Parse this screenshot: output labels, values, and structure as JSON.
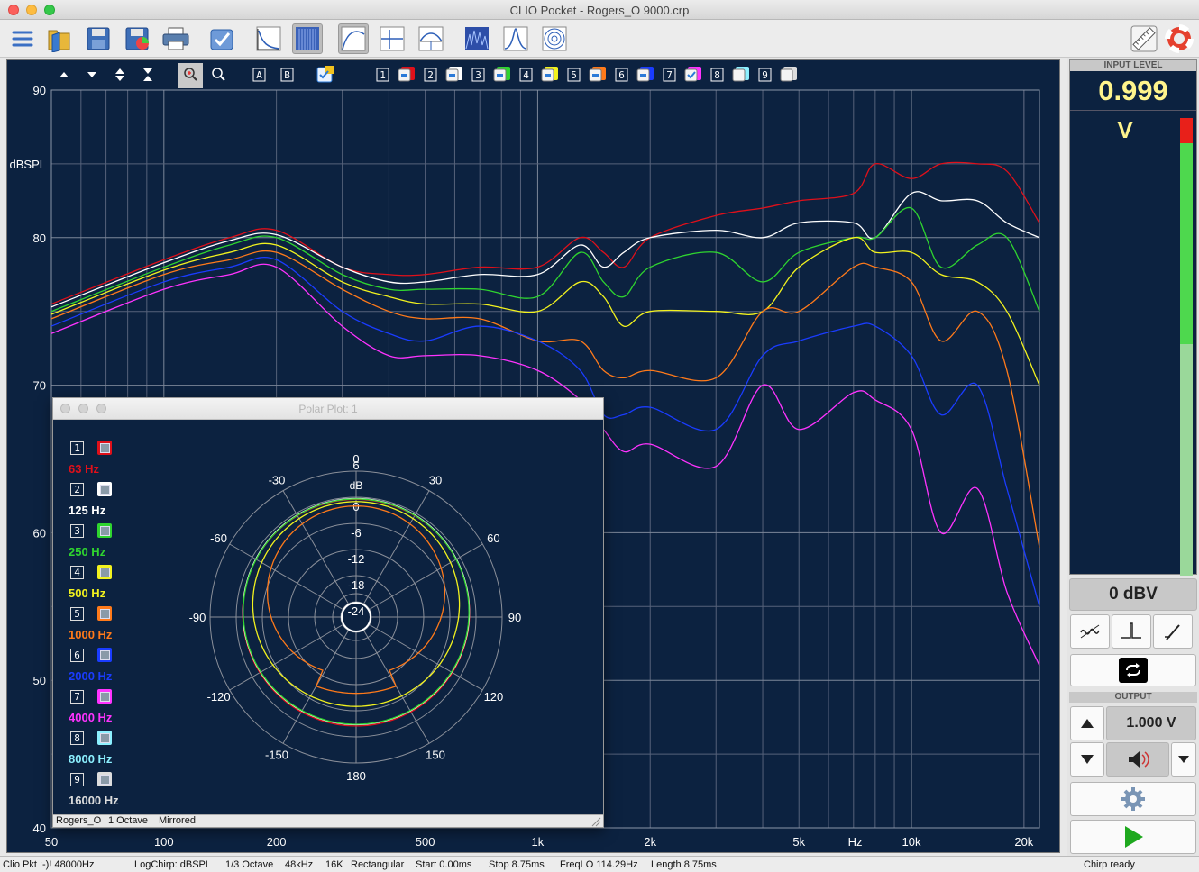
{
  "window": {
    "title": "CLIO Pocket - Rogers_O 9000.crp"
  },
  "toolbar": {
    "icons": [
      "menu-icon",
      "open-folder-icon",
      "save-icon",
      "save-as-icon",
      "print-icon",
      "checkmark-icon",
      "fft-analyzer-icon",
      "waterfall-icon",
      "frequency-response-icon",
      "impulse-response-icon",
      "phase-icon",
      "cumulative-spectral-decay-icon",
      "transfer-icon",
      "polar-plot-icon",
      "ruler-icon",
      "lifebuoy-help-icon"
    ]
  },
  "graph": {
    "controls": [
      "arrow-up-icon",
      "arrow-down-icon",
      "expand-icon",
      "compress-icon",
      "zoom-in-icon",
      "zoom-out-icon"
    ],
    "buttons": [
      "A",
      "B"
    ],
    "curve_numbers": [
      "1",
      "2",
      "3",
      "4",
      "5",
      "6",
      "7",
      "8",
      "9"
    ],
    "curve_colors": [
      "#e0101a",
      "#ffffff",
      "#2fd52f",
      "#f2f21e",
      "#ff7a1a",
      "#1a3cff",
      "#ff33ff",
      "#8cf0ff",
      "#dddddd"
    ],
    "y_axis": {
      "unit": "dBSPL",
      "ticks": [
        "90",
        "80",
        "70",
        "60",
        "50",
        "40"
      ]
    },
    "x_axis": {
      "unit": "Hz",
      "ticks": [
        "50",
        "100",
        "200",
        "500",
        "1k",
        "2k",
        "5k",
        "10k",
        "20k"
      ]
    }
  },
  "chart_data": {
    "type": "line",
    "title": "",
    "xlabel": "Hz",
    "ylabel": "dBSPL",
    "xscale": "log",
    "xlim": [
      50,
      22000
    ],
    "ylim": [
      40,
      90
    ],
    "grid": true,
    "series": [
      {
        "color": "#e0101a",
        "x": [
          50,
          100,
          150,
          200,
          300,
          400,
          500,
          700,
          1000,
          1300,
          1500,
          1700,
          2000,
          3000,
          4000,
          5000,
          7000,
          8000,
          10000,
          12000,
          15000,
          18000,
          22000
        ],
        "y": [
          75.5,
          78.5,
          80,
          80.5,
          78,
          77.5,
          77.5,
          78,
          78,
          80,
          79,
          78,
          80,
          81.5,
          82,
          82.5,
          83,
          85,
          84,
          85,
          85,
          84.5,
          81
        ]
      },
      {
        "color": "#ffffff",
        "x": [
          50,
          100,
          150,
          200,
          300,
          400,
          500,
          700,
          1000,
          1300,
          1500,
          1700,
          2000,
          3000,
          4000,
          5000,
          7000,
          8000,
          10000,
          12000,
          15000,
          18000,
          22000
        ],
        "y": [
          75.3,
          78.3,
          79.8,
          80.2,
          78,
          77,
          77,
          77.5,
          77.5,
          79.5,
          78,
          79,
          80,
          80.5,
          80,
          81,
          81,
          80,
          83,
          82.5,
          82.5,
          81,
          80
        ]
      },
      {
        "color": "#2fd52f",
        "x": [
          50,
          100,
          150,
          200,
          300,
          400,
          500,
          700,
          1000,
          1300,
          1500,
          1700,
          2000,
          3000,
          4000,
          5000,
          7000,
          8000,
          10000,
          12000,
          15000,
          18000,
          22000
        ],
        "y": [
          75,
          78,
          79.5,
          80,
          77.5,
          76.5,
          76.5,
          76.5,
          76,
          79,
          77,
          76,
          78,
          79,
          77,
          79,
          80,
          80,
          82,
          78,
          79.5,
          80,
          75
        ]
      },
      {
        "color": "#f2f21e",
        "x": [
          50,
          100,
          150,
          200,
          300,
          400,
          500,
          700,
          1000,
          1300,
          1500,
          1700,
          2000,
          3000,
          4000,
          5000,
          7000,
          8000,
          10000,
          12000,
          15000,
          18000,
          22000
        ],
        "y": [
          74.8,
          77.8,
          79,
          79.5,
          77,
          76,
          75.5,
          75.5,
          75,
          77,
          76,
          74,
          75,
          75,
          75,
          78,
          80,
          79,
          79,
          77.5,
          77,
          75,
          70
        ]
      },
      {
        "color": "#ff7a1a",
        "x": [
          50,
          100,
          150,
          200,
          300,
          400,
          500,
          700,
          1000,
          1300,
          1500,
          1700,
          2000,
          3000,
          4000,
          5000,
          7000,
          8000,
          10000,
          12000,
          15000,
          18000,
          22000
        ],
        "y": [
          74.5,
          77.5,
          78.5,
          79,
          76.5,
          75,
          74.5,
          74.5,
          73,
          73,
          71,
          70.5,
          71,
          70.5,
          75,
          75,
          78,
          78,
          77,
          73,
          75,
          71,
          59
        ]
      },
      {
        "color": "#1a3cff",
        "x": [
          50,
          100,
          150,
          200,
          300,
          400,
          500,
          700,
          1000,
          1300,
          1500,
          1700,
          2000,
          3000,
          4000,
          5000,
          7000,
          8000,
          10000,
          12000,
          15000,
          18000,
          22000
        ],
        "y": [
          74,
          77,
          78,
          78.5,
          75,
          73.5,
          73,
          74,
          73,
          71,
          68,
          68,
          68.5,
          67,
          72,
          73,
          74,
          74,
          72,
          68,
          70,
          63,
          55
        ]
      },
      {
        "color": "#ff33ff",
        "x": [
          50,
          100,
          150,
          200,
          300,
          400,
          500,
          700,
          1000,
          1300,
          1500,
          1700,
          2000,
          3000,
          4000,
          5000,
          7000,
          8000,
          10000,
          12000,
          15000,
          18000,
          22000
        ],
        "y": [
          73.5,
          76.5,
          77.5,
          78,
          74,
          72,
          72,
          72,
          71,
          69,
          67,
          65.5,
          66,
          64.5,
          70,
          67,
          69.5,
          69,
          67,
          60,
          63,
          56,
          51
        ]
      }
    ]
  },
  "polar": {
    "title": "Polar Plot: 1",
    "dB_label": "dB",
    "angle_labels": [
      "0",
      "30",
      "60",
      "90",
      "120",
      "150",
      "180",
      "-150",
      "-120",
      "-90",
      "-60",
      "-30"
    ],
    "rad_labels": [
      "6",
      "0",
      "-6",
      "-12",
      "-18",
      "-24"
    ],
    "legend": [
      {
        "num": "1",
        "hz": "63 Hz",
        "color": "#e0101a"
      },
      {
        "num": "2",
        "hz": "125 Hz",
        "color": "#ffffff"
      },
      {
        "num": "3",
        "hz": "250 Hz",
        "color": "#2fd52f"
      },
      {
        "num": "4",
        "hz": "500 Hz",
        "color": "#f2f21e"
      },
      {
        "num": "5",
        "hz": "1000 Hz",
        "color": "#ff7a1a"
      },
      {
        "num": "6",
        "hz": "2000 Hz",
        "color": "#1a3cff"
      },
      {
        "num": "7",
        "hz": "4000 Hz",
        "color": "#ff33ff"
      },
      {
        "num": "8",
        "hz": "8000 Hz",
        "color": "#8cf0ff"
      },
      {
        "num": "9",
        "hz": "16000 Hz",
        "color": "#dddddd"
      }
    ],
    "status": {
      "file": "Rogers_O",
      "smoothing": "1 Octave",
      "mode": "Mirrored"
    }
  },
  "input_level": {
    "label": "INPUT LEVEL",
    "value": "0.999",
    "unit": "V",
    "ref": "0 dBV"
  },
  "output": {
    "label": "OUTPUT",
    "value": "1.000 V"
  },
  "status": {
    "left": "Clio Pkt :-)! 48000Hz",
    "mode": "LogChirp:  dBSPL",
    "smoothing": "1/3 Octave",
    "rate": "48kHz",
    "size": "16K",
    "window": "Rectangular",
    "start": "Start 0.00ms",
    "stop": "Stop 8.75ms",
    "freqlo": "FreqLO 114.29Hz",
    "length": "Length 8.75ms",
    "right": "Chirp ready"
  }
}
